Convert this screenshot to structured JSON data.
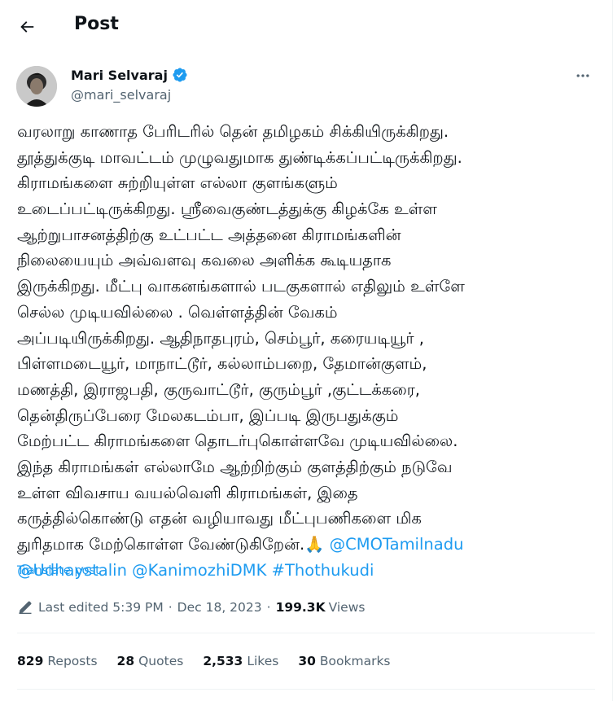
{
  "header": {
    "title": "Post"
  },
  "author": {
    "name": "Mari Selvaraj",
    "handle": "@mari_selvaraj"
  },
  "post": {
    "lines": [
      "வரலாறு காணாத பேரிடரில் தென் தமிழகம் சிக்கியிருக்கிறது.",
      "தூத்துக்குடி மாவட்டம் முழுவதுமாக துண்டிக்கப்பட்டிருக்கிறது.",
      "கிராமங்களை சுற்றியுள்ள எல்லா குளங்களும்",
      "உடைப்பட்டிருக்கிறது. ஸ்ரீவைகுண்டத்துக்கு கிழக்கே உள்ள",
      "ஆற்றுபாசனத்திற்கு உட்பட்ட அத்தனை கிராமங்களின்",
      "நிலையையும் அவ்வளவு கவலை அளிக்க கூடியதாக",
      "இருக்கிறது. மீட்பு வாகனங்களால் படகுகளால் எதிலும் உள்ளே",
      "செல்ல முடியவில்லை . வெள்ளத்தின்  வேகம்",
      "அப்படியிருக்கிறது. ஆதிநாதபுரம், செம்பூர், கரையடியூர் ,",
      "பிள்ளமடையூர், மாநாட்டூர், கல்லாம்பறை, தேமான்குளம்,",
      "மணத்தி, இராஜபதி, குருவாட்டூர், குரும்பூர் ,குட்டக்கரை,",
      "தென்திருப்பேரை மேலகடம்பா, இப்படி இருபதுக்கும்",
      "மேற்பட்ட கிராமங்களை தொடர்புகொள்ளவே முடியவில்லை.",
      "இந்த கிராமங்கள் எல்லாமே ஆற்றிற்கும் குளத்திற்கும் நடுவே",
      "உள்ள விவசாய வயல்வெளி கிராமங்கள், இதை",
      "கருத்தில்கொண்டு எதன் வழியாவது மீட்புபணிகளை மிக"
    ],
    "last_line_text": "துரிதமாக மேற்கொள்ள வேண்டுகிறேன்.🙏 ",
    "mention_cmo": "@CMOTamilnadu",
    "mention_udhay": "@Udhaystalin",
    "mention_kanimozhi": "@KanimozhiDMK",
    "hashtag": "#Thothukudi"
  },
  "translate_label": "Translate post",
  "meta": {
    "edited_label": "Last edited 5:39 PM",
    "separator": "·",
    "date": "Dec 18, 2023",
    "views_count": "199.3K",
    "views_label": "Views"
  },
  "stats": {
    "reposts_count": "829",
    "reposts_label": "Reposts",
    "quotes_count": "28",
    "quotes_label": "Quotes",
    "likes_count": "2,533",
    "likes_label": "Likes",
    "bookmarks_count": "30",
    "bookmarks_label": "Bookmarks"
  },
  "colors": {
    "link": "#1d9bf0",
    "secondary_text": "#536471",
    "verified": "#1d9bf0",
    "divider": "#eff3f4"
  },
  "icons": {
    "back": "arrow-left-icon",
    "verified": "verified-badge-icon",
    "more": "more-horizontal-icon",
    "edited": "pencil-icon"
  }
}
